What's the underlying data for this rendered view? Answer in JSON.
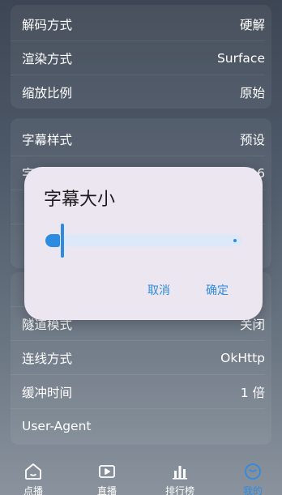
{
  "settings": {
    "top_rows": [
      {
        "label": "解码方式",
        "value": "硬解"
      },
      {
        "label": "渲染方式",
        "value": "Surface"
      },
      {
        "label": "缩放比例",
        "value": "原始"
      }
    ],
    "mid_rows": [
      {
        "label": "字幕样式",
        "value": "预设"
      },
      {
        "label": "字",
        "value": "16"
      },
      {
        "label": "",
        "value": ""
      },
      {
        "label": "",
        "value": ""
      }
    ],
    "bottom_rows": [
      {
        "label": "",
        "value": ""
      },
      {
        "label": "隧道模式",
        "value": "关闭"
      },
      {
        "label": "连线方式",
        "value": "OkHttp"
      },
      {
        "label": "缓冲时间",
        "value": "1 倍"
      },
      {
        "label": "User-Agent",
        "value": ""
      }
    ]
  },
  "dialog": {
    "title": "字幕大小",
    "slider_fraction": 0.0,
    "cancel_label": "取消",
    "ok_label": "确定"
  },
  "nav": {
    "items": [
      {
        "label": "点播",
        "icon": "home-icon"
      },
      {
        "label": "直播",
        "icon": "play-icon"
      },
      {
        "label": "排行榜",
        "icon": "bar-chart-icon"
      },
      {
        "label": "我的",
        "icon": "user-icon"
      }
    ],
    "active_index": 3
  },
  "colors": {
    "accent": "#2d8be0",
    "dialog_bg": "#ece6f1"
  }
}
